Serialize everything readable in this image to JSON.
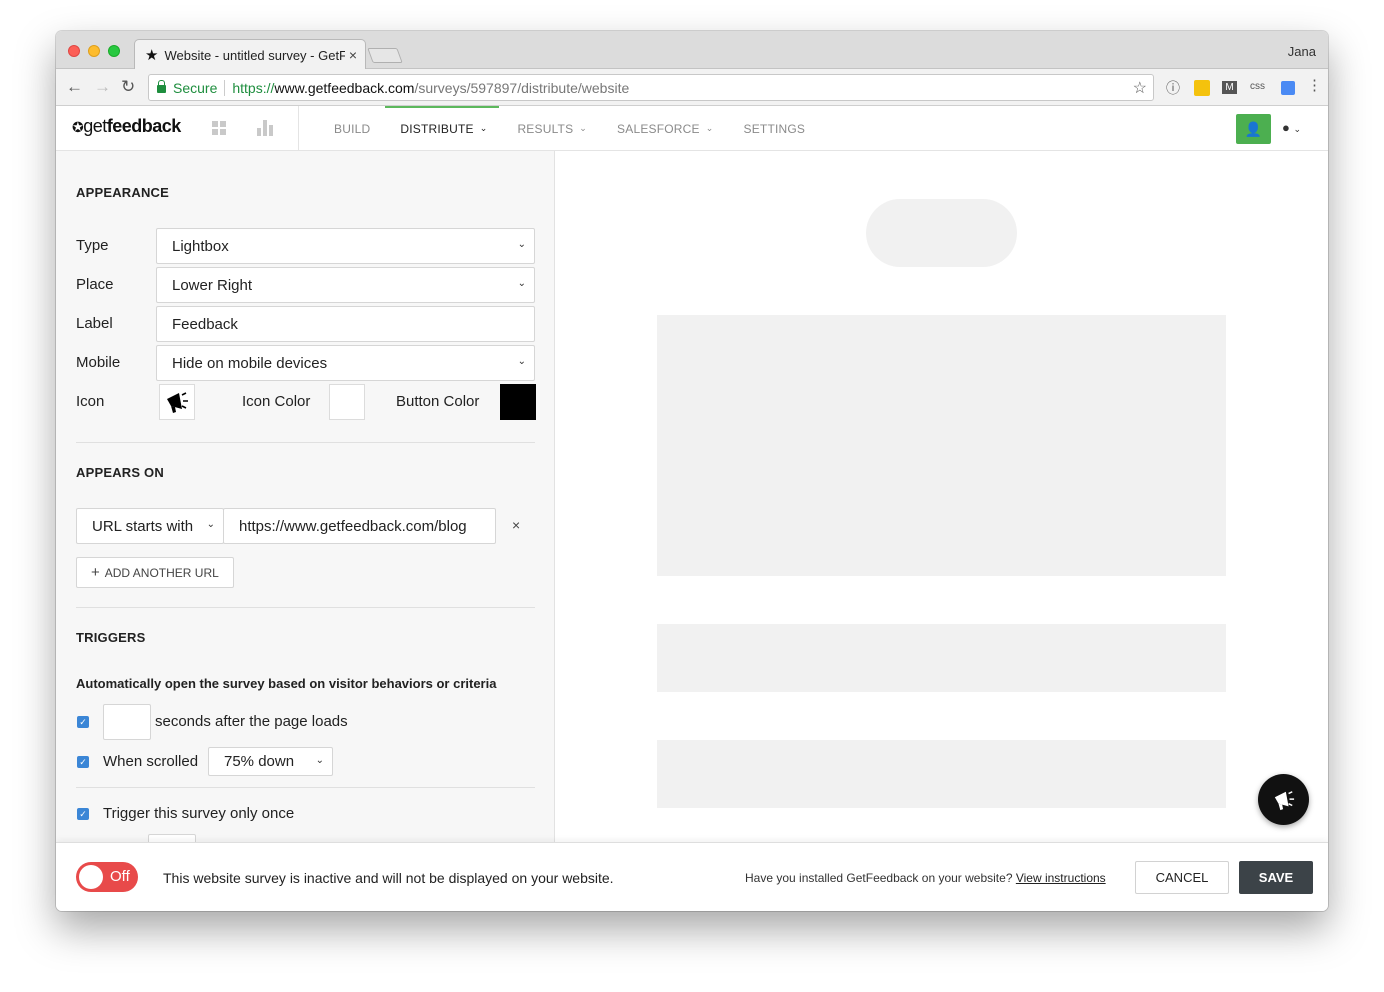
{
  "browser": {
    "tab_title": "Website - untitled survey - GetFeedback",
    "tab_close": "×",
    "user": "Jana",
    "secure_label": "Secure",
    "url_proto": "https://",
    "url_host": "www.getfeedback.com",
    "url_path": "/surveys/597897/distribute/website"
  },
  "app": {
    "logo_light": "get",
    "logo_bold": "feedback",
    "nav": [
      {
        "label": "BUILD"
      },
      {
        "label": "DISTRIBUTE"
      },
      {
        "label": "RESULTS"
      },
      {
        "label": "SALESFORCE"
      },
      {
        "label": "SETTINGS"
      }
    ]
  },
  "appearance": {
    "heading": "APPEARANCE",
    "type_label": "Type",
    "type_value": "Lightbox",
    "place_label": "Place",
    "place_value": "Lower Right",
    "label_label": "Label",
    "label_value": "Feedback",
    "mobile_label": "Mobile",
    "mobile_value": "Hide on mobile devices",
    "icon_label": "Icon",
    "icon_color_label": "Icon Color",
    "button_color_label": "Button Color",
    "icon_color": "#ffffff",
    "button_color": "#000000"
  },
  "appears_on": {
    "heading": "APPEARS ON",
    "match_value": "URL starts with",
    "url_value": "https://www.getfeedback.com/blog",
    "remove": "×",
    "add_label": "ADD ANOTHER URL",
    "add_plus": "+"
  },
  "triggers": {
    "heading": "TRIGGERS",
    "description": "Automatically open the survey based on visitor behaviors or criteria",
    "seconds_text": "seconds after the page loads",
    "seconds_value": "",
    "scrolled_label": "When scrolled",
    "scroll_value": "75% down",
    "once_label": "Trigger this survey only once"
  },
  "footer": {
    "toggle_label": "Off",
    "status": "This website survey is inactive and will not be displayed on your website.",
    "installed_q": "Have you installed GetFeedback on your website?",
    "view_instructions": "View instructions",
    "cancel": "CANCEL",
    "save": "SAVE"
  },
  "colors": {
    "accent_green": "#4caf50",
    "toggle_off_red": "#e84a4a",
    "save_dark": "#3c4348"
  }
}
